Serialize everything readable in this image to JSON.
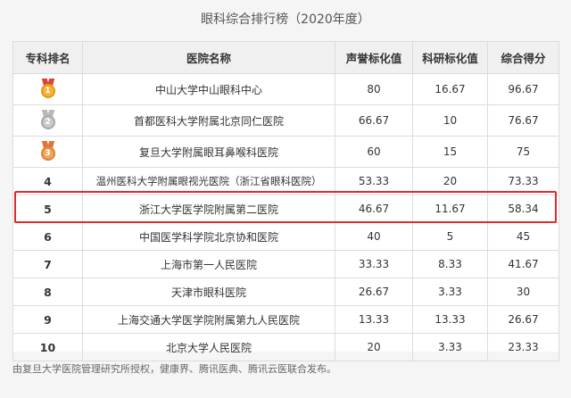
{
  "title": "眼科综合排行榜（2020年度）",
  "headers": [
    "专科排名",
    "医院名称",
    "声誉标化值",
    "科研标化值",
    "综合得分"
  ],
  "rows": [
    {
      "rank": "1",
      "medal": "gold",
      "hospital": "中山大学中山眼科中心",
      "reputation": "80",
      "research": "16.67",
      "total": "96.67"
    },
    {
      "rank": "2",
      "medal": "silver",
      "hospital": "首都医科大学附属北京同仁医院",
      "reputation": "66.67",
      "research": "10",
      "total": "76.67"
    },
    {
      "rank": "3",
      "medal": "bronze",
      "hospital": "复旦大学附属眼耳鼻喉科医院",
      "reputation": "60",
      "research": "15",
      "total": "75"
    },
    {
      "rank": "4",
      "hospital": "温州医科大学附属眼视光医院（浙江省眼科医院）",
      "reputation": "53.33",
      "research": "20",
      "total": "73.33"
    },
    {
      "rank": "5",
      "hospital": "浙江大学医学院附属第二医院",
      "reputation": "46.67",
      "research": "11.67",
      "total": "58.34"
    },
    {
      "rank": "6",
      "hospital": "中国医学科学院北京协和医院",
      "reputation": "40",
      "research": "5",
      "total": "45"
    },
    {
      "rank": "7",
      "hospital": "上海市第一人民医院",
      "reputation": "33.33",
      "research": "8.33",
      "total": "41.67"
    },
    {
      "rank": "8",
      "hospital": "天津市眼科医院",
      "reputation": "26.67",
      "research": "3.33",
      "total": "30"
    },
    {
      "rank": "9",
      "hospital": "上海交通大学医学院附属第九人民医院",
      "reputation": "13.33",
      "research": "13.33",
      "total": "26.67"
    },
    {
      "rank": "10",
      "hospital": "北京大学人民医院",
      "reputation": "20",
      "research": "3.33",
      "total": "23.33"
    }
  ],
  "highlighted_rank": "5",
  "highlight_color": "#e02b2b",
  "footnote": "由复旦大学医院管理研究所授权，健康界、腾讯医典、腾讯云医联合发布。"
}
